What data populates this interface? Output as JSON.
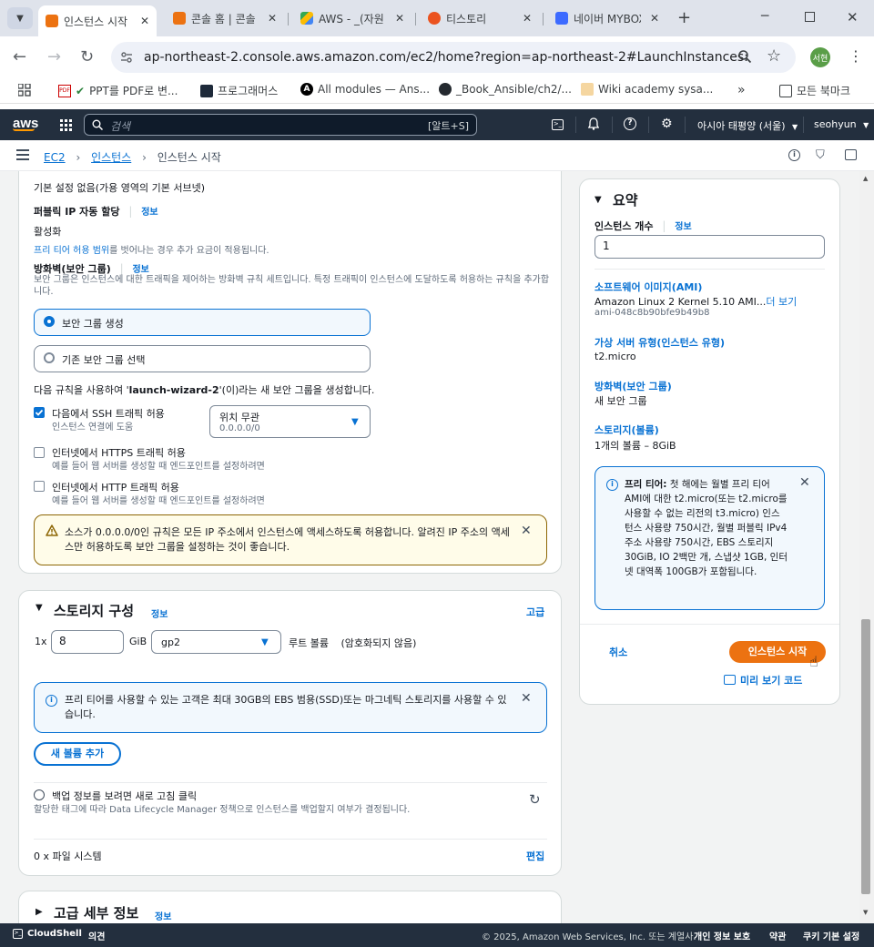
{
  "browser": {
    "tabs": [
      {
        "label": "인스턴스 시작",
        "active": true
      },
      {
        "label": "콘솔 홈 | 콘솔",
        "active": false
      },
      {
        "label": "AWS - _(자원",
        "active": false
      },
      {
        "label": "티스토리",
        "active": false
      },
      {
        "label": "네이버 MYBOX",
        "active": false
      }
    ],
    "url": "ap-northeast-2.console.aws.amazon.com/ec2/home?region=ap-northeast-2#LaunchInstances:",
    "profile_badge": "서현",
    "bookmarks": [
      "PPT를 PDF로 변...",
      "프로그래머스",
      "All modules — Ans...",
      "_Book_Ansible/ch2/...",
      "Wiki academy sysa..."
    ],
    "all_bookmarks": "모든 북마크"
  },
  "aws_nav": {
    "logo": "aws",
    "search_placeholder": "검색",
    "search_shortcut": "[알트+S]",
    "region": "아시아 태평양 (서울)",
    "user": "seohyun"
  },
  "breadcrumb": {
    "items": [
      "EC2",
      "인스턴스",
      "인스턴스 시작"
    ]
  },
  "network": {
    "subnet_value": "기본 설정 없음(가용 영역의 기본 서브넷)",
    "public_ip_label": "퍼블릭 IP 자동 할당",
    "info": "정보",
    "public_ip_value": "활성화",
    "free_tier_link": "프리 티어 허용 범위",
    "free_tier_suffix": "를 벗어나는 경우 추가 요금이 적용됩니다.",
    "firewall_label": "방화벽(보안 그룹)",
    "firewall_desc": "보안 그룹은 인스턴스에 대한 트래픽을 제어하는 방화벽 규칙 세트입니다. 특정 트래픽이 인스턴스에 도달하도록 허용하는 규칙을 추가합니다.",
    "option_create": "보안 그룹 생성",
    "option_select": "기존 보안 그룹 선택",
    "rule_prefix": "다음 규칙을 사용하여 '",
    "rule_name": "launch-wizard-2",
    "rule_suffix": "'(이)라는 새 보안 그룹을 생성합니다.",
    "ssh_label": "다음에서 SSH 트래픽 허용",
    "ssh_desc": "인스턴스 연결에 도움",
    "ssh_select_value": "위치 무관",
    "ssh_select_sub": "0.0.0.0/0",
    "https_label": "인터넷에서 HTTPS 트래픽 허용",
    "https_desc": "예를 들어 웹 서버를 생성할 때 엔드포인트를 설정하려면",
    "http_label": "인터넷에서 HTTP 트래픽 허용",
    "http_desc": "예를 들어 웹 서버를 생성할 때 엔드포인트를 설정하려면",
    "warning": "소스가 0.0.0.0/0인 규칙은 모든 IP 주소에서 인스턴스에 액세스하도록 허용합니다. 알려진 IP 주소의 액세스만 허용하도록 보안 그룹을 설정하는 것이 좋습니다."
  },
  "storage": {
    "title": "스토리지 구성",
    "info": "정보",
    "advanced": "고급",
    "count_prefix": "1x",
    "size": "8",
    "unit": "GiB",
    "volume_type": "gp2",
    "root_label": "루트 볼륨",
    "encryption": "(암호화되지 않음)",
    "free_tier_note": "프리 티어를 사용할 수 있는 고객은 최대 30GB의 EBS 범용(SSD)또는 마그네틱 스토리지를 사용할 수 있습니다.",
    "add_volume": "새 볼륨 추가",
    "backup_title": "백업 정보를 보려면 새로 고침 클릭",
    "backup_desc": "할당한 태그에 따라 Data Lifecycle Manager 정책으로 인스턴스를 백업할지 여부가 결정됩니다.",
    "filesystems": "0 x 파일 시스템",
    "edit": "편집"
  },
  "advanced": {
    "title": "고급 세부 정보",
    "info": "정보"
  },
  "summary": {
    "title": "요약",
    "instance_count_label": "인스턴스 개수",
    "info": "정보",
    "instance_count": "1",
    "ami_title": "소프트웨어 이미지(AMI)",
    "ami_value": "Amazon Linux 2 Kernel 5.10 AMI...",
    "ami_more": "더 보기",
    "ami_id": "ami-048c8b90bfe9b49b8",
    "type_title": "가상 서버 유형(인스턴스 유형)",
    "type_value": "t2.micro",
    "firewall_title": "방화벽(보안 그룹)",
    "firewall_value": "새 보안 그룹",
    "storage_title": "스토리지(볼륨)",
    "storage_value": "1개의 볼륨 – 8GiB",
    "free_tier_bold": "프리 티어:",
    "free_tier_text": " 첫 해에는 월별 프리 티어 AMI에 대한 t2.micro(또는 t2.micro를 사용할 수 없는 리전의 t3.micro) 인스턴스 사용량 750시간, 월별 퍼블릭 IPv4 주소 사용량 750시간, EBS 스토리지 30GiB, IO 2백만 개, 스냅샷 1GB, 인터넷 대역폭 100GB가 포함됩니다.",
    "cancel": "취소",
    "launch": "인스턴스 시작",
    "preview_code": "미리 보기 코드"
  },
  "footer": {
    "cloudshell": "CloudShell",
    "feedback": "의견",
    "copyright": "© 2025, Amazon Web Services, Inc. 또는 계열사.",
    "privacy": "개인 정보 보호",
    "terms": "약관",
    "cookies": "쿠키 기본 설정"
  },
  "colors": {
    "aws_dark": "#232f3e",
    "link_blue": "#0972d3",
    "primary_orange": "#ec7211"
  }
}
